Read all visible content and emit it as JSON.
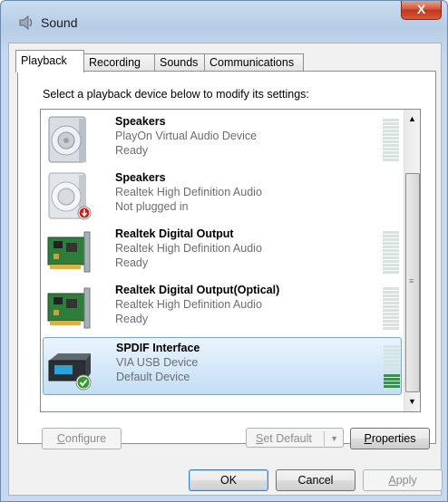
{
  "window": {
    "title": "Sound",
    "close_label": "X"
  },
  "tabs": [
    {
      "label": "Playback",
      "active": true
    },
    {
      "label": "Recording",
      "active": false
    },
    {
      "label": "Sounds",
      "active": false
    },
    {
      "label": "Communications",
      "active": false
    }
  ],
  "instruction": "Select a playback device below to modify its settings:",
  "devices": [
    {
      "name": "Speakers",
      "description": "PlayOn Virtual Audio Device",
      "status": "Ready",
      "icon": "speaker-icon",
      "level": 0
    },
    {
      "name": "Speakers",
      "description": "Realtek High Definition Audio",
      "status": "Not plugged in",
      "icon": "speaker-unplugged-icon",
      "level": 0
    },
    {
      "name": "Realtek Digital Output",
      "description": "Realtek High Definition Audio",
      "status": "Ready",
      "icon": "sound-card-icon",
      "level": 0
    },
    {
      "name": "Realtek Digital Output(Optical)",
      "description": "Realtek High Definition Audio",
      "status": "Ready",
      "icon": "sound-card-icon",
      "level": 0
    },
    {
      "name": "SPDIF Interface",
      "description": "VIA USB Device",
      "status": "Default Device",
      "icon": "usb-audio-device-default-icon",
      "level": 0.3,
      "selected": true
    }
  ],
  "buttons": {
    "configure": {
      "first": "C",
      "rest": "onfigure"
    },
    "set_default": {
      "first": "S",
      "rest": "et Default"
    },
    "properties": {
      "first": "P",
      "rest": "roperties"
    },
    "ok": "OK",
    "cancel": "Cancel",
    "apply": {
      "first": "A",
      "rest": "pply"
    }
  },
  "colors": {
    "selection": "#c3def5",
    "meter_on": "#1fa81f",
    "meter_off": "#d4e6dc"
  }
}
